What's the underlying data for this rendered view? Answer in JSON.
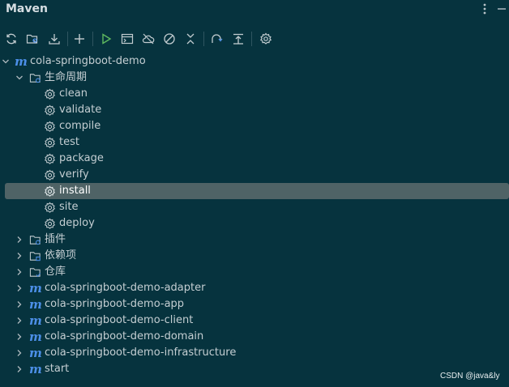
{
  "header": {
    "title": "Maven",
    "more_icon": "kebab-menu-icon",
    "minimize_icon": "minimize-icon"
  },
  "toolbar": {
    "buttons": [
      {
        "name": "reload-all-projects",
        "icon": "refresh-icon"
      },
      {
        "name": "generate-sources",
        "icon": "folder-generate-icon"
      },
      {
        "name": "download-sources",
        "icon": "download-icon"
      },
      {
        "name": "add-maven-project",
        "icon": "plus-icon"
      },
      {
        "name": "run-maven-build",
        "icon": "run-icon"
      },
      {
        "name": "execute-maven-goal",
        "icon": "terminal-icon"
      },
      {
        "name": "toggle-offline-mode",
        "icon": "offline-cloud-icon"
      },
      {
        "name": "skip-tests",
        "icon": "skip-tests-icon"
      },
      {
        "name": "collapse-all",
        "icon": "collapse-icon"
      },
      {
        "name": "show-dependencies",
        "icon": "dependencies-icon"
      },
      {
        "name": "expand-collapse",
        "icon": "align-top-icon"
      },
      {
        "name": "maven-settings",
        "icon": "settings-gear-icon"
      }
    ]
  },
  "tree": {
    "root": "cola-springboot-demo",
    "lifecycle": {
      "label": "生命周期",
      "goals": [
        "clean",
        "validate",
        "compile",
        "test",
        "package",
        "verify",
        "install",
        "site",
        "deploy"
      ],
      "selected": "install"
    },
    "plugins": "插件",
    "dependencies": "依赖项",
    "repositories": "仓库",
    "modules": [
      "cola-springboot-demo-adapter",
      "cola-springboot-demo-app",
      "cola-springboot-demo-client",
      "cola-springboot-demo-domain",
      "cola-springboot-demo-infrastructure",
      "start"
    ]
  },
  "watermark": "CSDN @java&ly",
  "colors": {
    "background": "#06333e",
    "selection": "#4f6366",
    "maven_icon": "#4c8fe8",
    "run_green": "#5fb85f"
  }
}
